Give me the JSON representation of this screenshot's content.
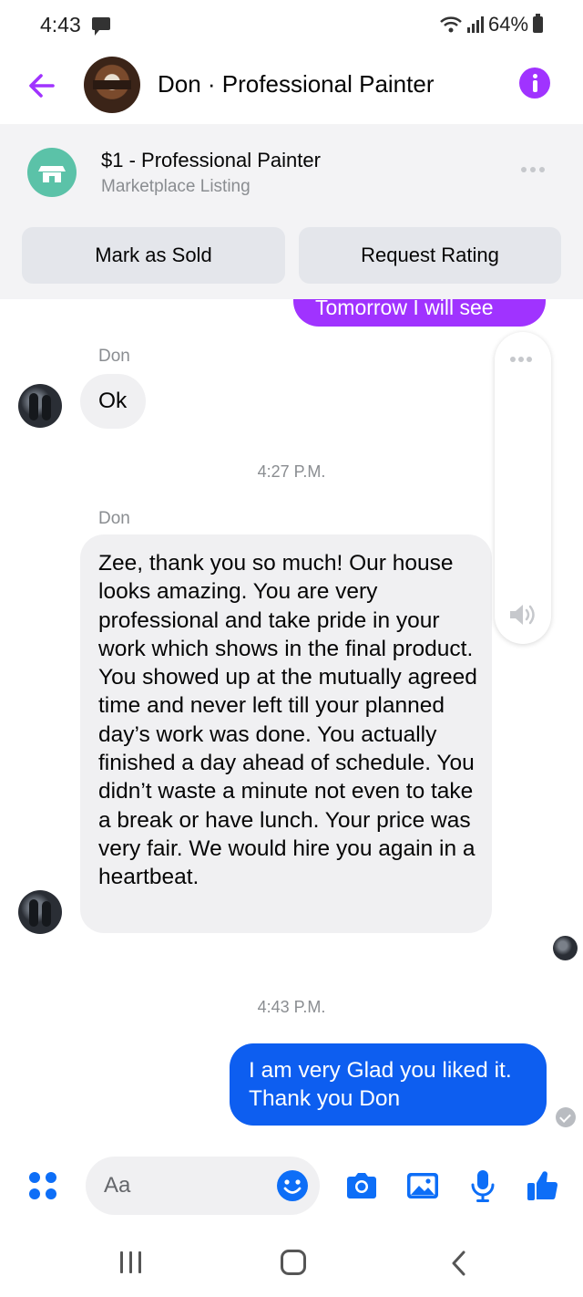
{
  "status_bar": {
    "time": "4:43",
    "battery": "64%"
  },
  "header": {
    "title": "Don · Professional Painter"
  },
  "listing": {
    "title": "$1 - Professional Painter",
    "subtitle": "Marketplace Listing",
    "mark_sold_label": "Mark as Sold",
    "request_rating_label": "Request Rating"
  },
  "messages": {
    "partial_outgoing": "Tomorrow I will see",
    "sender_1": "Don",
    "ok_text": "Ok",
    "timestamp_1": "4:27 P.M.",
    "sender_2": "Don",
    "review_text": "Zee, thank you so much!  Our house looks amazing. You are very professional and take pride in your work which shows in the final product. You showed up at the mutually agreed time and never left till your planned day’s work was done.  You actually finished a day ahead of schedule. You didn’t waste a minute not even to take a break or have lunch. Your price was very fair. We would hire you again in a heartbeat.",
    "timestamp_2": "4:43 P.M.",
    "reply_text": "I am very Glad you liked it. Thank you Don"
  },
  "composer": {
    "placeholder": "Aa"
  },
  "colors": {
    "accent_purple": "#a033ff",
    "outgoing_blue": "#0d5ef0",
    "icon_blue": "#0d6ef7",
    "listing_green": "#5bc2a8"
  },
  "icons": {
    "back": "arrow-left-icon",
    "info": "info-icon",
    "store": "store-icon",
    "apps": "four-dots-icon",
    "emoji": "smile-icon",
    "camera": "camera-icon",
    "gallery": "image-icon",
    "mic": "microphone-icon",
    "like": "thumbs-up-icon"
  }
}
